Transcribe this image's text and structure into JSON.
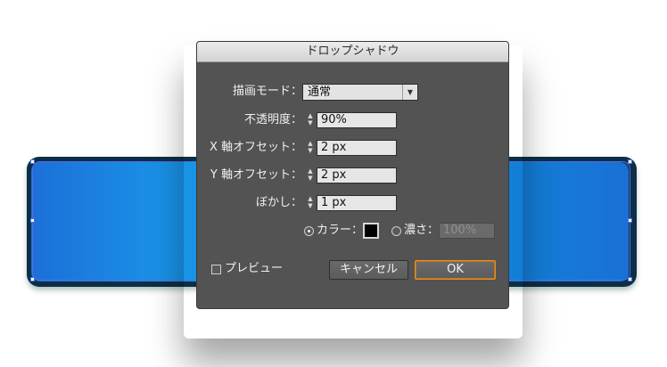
{
  "dialog": {
    "title": "ドロップシャドウ",
    "mode": {
      "label": "描画モード：",
      "value": "通常",
      "arrow_icon": "triangle-down"
    },
    "opacity": {
      "label": "不透明度：",
      "value": "90%"
    },
    "x_offset": {
      "label": "X 軸オフセット：",
      "value": "2 px"
    },
    "y_offset": {
      "label": "Y 軸オフセット：",
      "value": "2 px"
    },
    "blur": {
      "label": "ぼかし：",
      "value": "1 px"
    },
    "color_option": {
      "label": "カラー：",
      "selected": true,
      "swatch_color": "#000000"
    },
    "darkness_option": {
      "label": "濃さ：",
      "selected": false,
      "value": "100%"
    },
    "preview": {
      "label": "プレビュー",
      "checked": false
    },
    "buttons": {
      "cancel": "キャンセル",
      "ok": "OK"
    }
  },
  "artwork": {
    "fill_colors": [
      "#1d6fd8",
      "#12a2e4",
      "#1a70d6"
    ],
    "outline_color": "#0c2f45",
    "selection_color": "#4d6fe8"
  }
}
